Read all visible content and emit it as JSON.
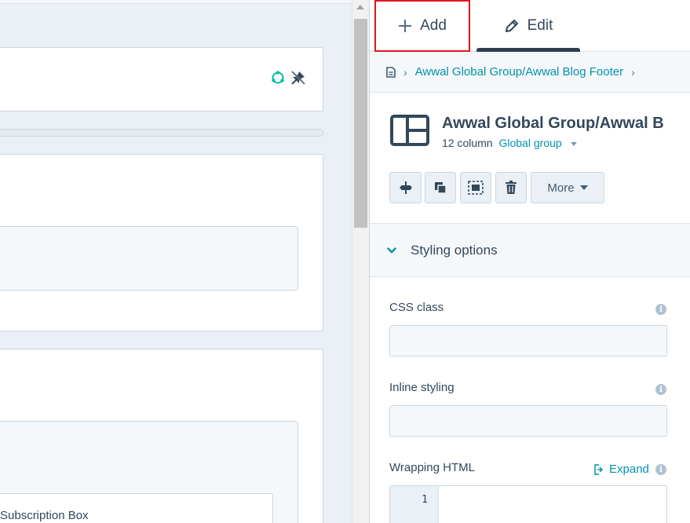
{
  "canvas": {
    "subscription_text": "Subscription Box",
    "card_icons": [
      "refresh-icon",
      "pin-off-icon"
    ]
  },
  "tabs": {
    "add_label": "Add",
    "edit_label": "Edit",
    "active": "Edit"
  },
  "breadcrumb": {
    "path": "Awwal Global Group/Awwal Blog Footer"
  },
  "module": {
    "title": "Awwal Global Group/Awwal B",
    "column_text": "12 column",
    "group_label": "Global group"
  },
  "toolbar": {
    "more_label": "More"
  },
  "styling": {
    "section_label": "Styling options",
    "css_class_label": "CSS class",
    "css_class_value": "",
    "inline_styling_label": "Inline styling",
    "inline_styling_value": "",
    "wrapping_html_label": "Wrapping HTML",
    "expand_label": "Expand",
    "line_number": "1"
  },
  "colors": {
    "accent": "#0091ae",
    "highlight_border": "#e0161b",
    "text": "#33475b"
  }
}
